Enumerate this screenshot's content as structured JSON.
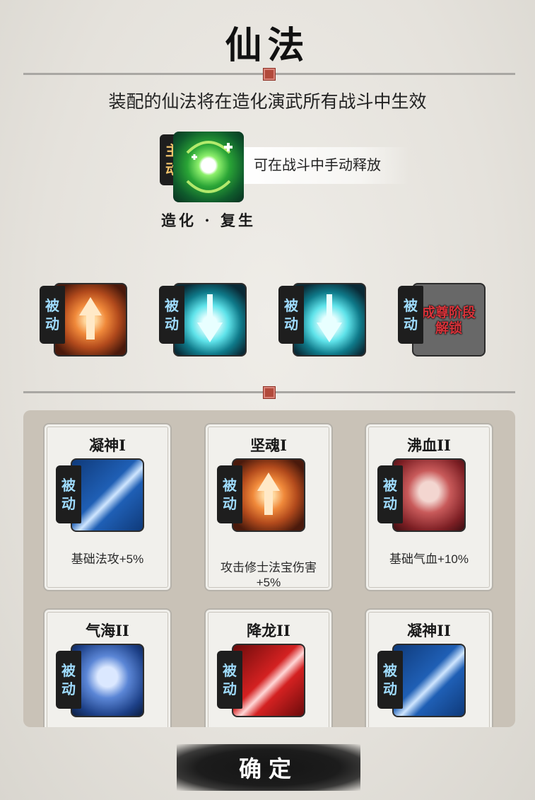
{
  "title": "仙法",
  "subtitle": "装配的仙法将在造化演武所有战斗中生效",
  "active_skill": {
    "tag": [
      "主",
      "动"
    ],
    "name": "造化 · 复生",
    "desc": "可在战斗中手动释放",
    "icon": "green-heal-orb-icon"
  },
  "passive_slots": [
    {
      "tag": [
        "被",
        "动"
      ],
      "icon": "fire-arrow-icon"
    },
    {
      "tag": [
        "被",
        "动"
      ],
      "icon": "teal-sword-shield-icon"
    },
    {
      "tag": [
        "被",
        "动"
      ],
      "icon": "teal-sword-shield-icon"
    },
    {
      "tag": [
        "被",
        "动"
      ],
      "icon": "locked-icon",
      "lock_text": [
        "成尊阶段",
        "解锁"
      ]
    }
  ],
  "skill_cards": [
    {
      "name": "凝神I",
      "tag": [
        "被",
        "动"
      ],
      "icon": "blue-sword-icon",
      "desc": "基础法攻+5%"
    },
    {
      "name": "坚魂I",
      "tag": [
        "被",
        "动"
      ],
      "icon": "fire-arrow-icon",
      "desc": "攻击修士法宝伤害+5%"
    },
    {
      "name": "沸血II",
      "tag": [
        "被",
        "动"
      ],
      "icon": "red-ghost-icon",
      "desc": "基础气血+10%"
    },
    {
      "name": "气海II",
      "tag": [
        "被",
        "动"
      ],
      "icon": "blue-ghost-icon",
      "desc": ""
    },
    {
      "name": "降龙II",
      "tag": [
        "被",
        "动"
      ],
      "icon": "red-sword-icon",
      "desc": ""
    },
    {
      "name": "凝神II",
      "tag": [
        "被",
        "动"
      ],
      "icon": "blue-sword-icon",
      "desc": ""
    }
  ],
  "confirm_label": "确定",
  "colors": {
    "passive_tag": "#9fdcff",
    "active_tag": "#f1c46c",
    "lock_text": "#d8333a",
    "panel": "#c9c2b7"
  }
}
